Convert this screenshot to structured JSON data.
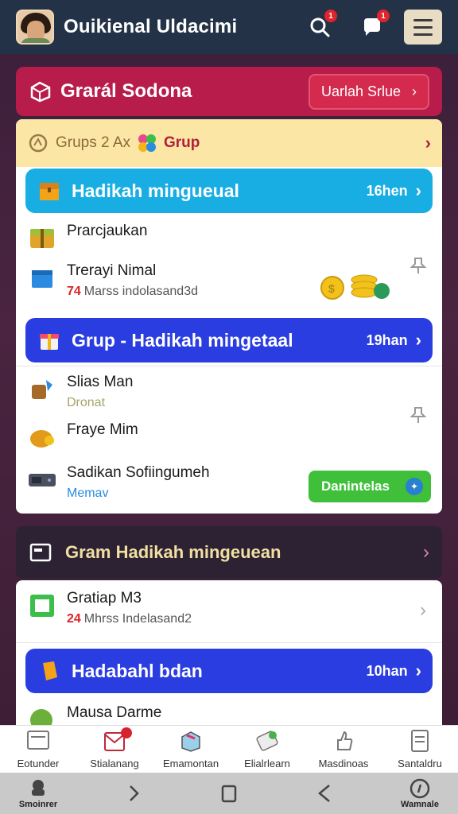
{
  "topbar": {
    "title": "Ouikienal Uldacimi",
    "search_badge": "1",
    "chat_badge": "1"
  },
  "header": {
    "title": "Grarál Sodona",
    "button_label": "Uarlah Srlue",
    "button_chevron": "›"
  },
  "grup_row": {
    "label": "Grups 2 Ax",
    "label2": "Grup",
    "chevron": "›"
  },
  "banner1": {
    "title": "Hadikah mingueual",
    "meta": "16hen",
    "chevron": "›",
    "color": "#19aee3"
  },
  "items1": [
    {
      "name": "Prarcjaukan",
      "sub": ""
    },
    {
      "name": "Trerayi Nimal",
      "sub_num": "74",
      "sub": "Marss indolasand3d"
    }
  ],
  "banner2": {
    "title": "Grup - Hadikah mingetaal",
    "meta": "19han",
    "chevron": "›",
    "color": "#2a3de0"
  },
  "items2": [
    {
      "name": "Slias Man",
      "sub": "Dronat"
    },
    {
      "name": "Fraye Mim",
      "sub": ""
    },
    {
      "name": "Sadikan Sofiingumeh",
      "sub": "Memav"
    }
  ],
  "green_button": {
    "label": "Danintelas"
  },
  "section2": {
    "title": "Gram Hadikah mingeuean",
    "chevron": "›"
  },
  "items3": [
    {
      "name": "Gratiap M3",
      "sub_num": "24",
      "sub": "Mhrss Indelasand2"
    }
  ],
  "banner3": {
    "title": "Hadabahl bdan",
    "meta": "10han",
    "chevron": "›",
    "color": "#2a3de0"
  },
  "items4": [
    {
      "name": "Mausa Darme"
    }
  ],
  "bottom_nav": [
    {
      "label": "Eotunder"
    },
    {
      "label": "Stialanang"
    },
    {
      "label": "Emamontan"
    },
    {
      "label": "Elialrlearn"
    },
    {
      "label": "Masdinoas"
    },
    {
      "label": "Santaldru"
    }
  ],
  "system_bar": {
    "left_label": "Smoinrer",
    "right_label": "Wamnale"
  }
}
